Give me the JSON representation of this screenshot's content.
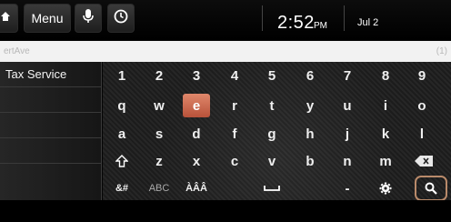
{
  "status_bar": {
    "menu_label": "Menu",
    "time": "2:52",
    "ampm": "PM",
    "date": "Jul 2"
  },
  "search": {
    "value": "ertAve",
    "count": "(1)"
  },
  "suggestions": [
    {
      "label": "Tax Service"
    },
    {
      "label": ""
    },
    {
      "label": ""
    },
    {
      "label": ""
    },
    {
      "label": ""
    }
  ],
  "keyboard": {
    "row1": [
      "1",
      "2",
      "3",
      "4",
      "5",
      "6",
      "7",
      "8",
      "9"
    ],
    "row2": [
      "q",
      "w",
      "e",
      "r",
      "t",
      "y",
      "u",
      "i",
      "o"
    ],
    "row3": [
      "a",
      "s",
      "d",
      "f",
      "g",
      "h",
      "j",
      "k",
      "l"
    ],
    "row4": [
      "z",
      "x",
      "c",
      "v",
      "b",
      "n",
      "m"
    ],
    "row5_symbols": "&#",
    "row5_abc": "ABC",
    "row5_accents": "ÀÂÂ",
    "row5_dash": "-",
    "selected_key": "e"
  },
  "icons": {
    "home": "home-icon",
    "mic": "microphone-icon",
    "clock": "clock-icon",
    "shift": "shift-icon",
    "backspace": "backspace-icon",
    "space": "space-icon",
    "settings": "gear-icon",
    "search": "search-icon"
  },
  "colors": {
    "selected_key": "#c8654a",
    "search_highlight": "#b98a6a"
  }
}
